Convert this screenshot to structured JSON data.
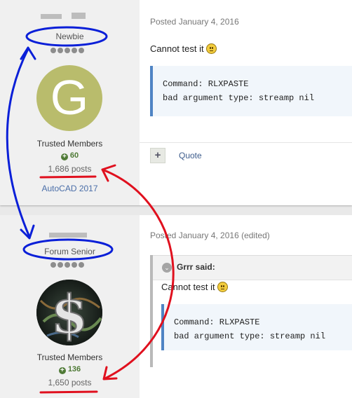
{
  "posts": [
    {
      "author": {
        "rank": "Newbie",
        "group": "Trusted Members",
        "reputation": "60",
        "post_count": "1,686 posts",
        "software": "AutoCAD 2017",
        "avatar_letter": "G",
        "avatar_color": "#b9bc6c"
      },
      "meta": "Posted January 4, 2016",
      "body_text": "Cannot test it",
      "code": "Command: RLXPASTE\nbad argument type: streamp nil",
      "actions": {
        "plus": "+",
        "quote": "Quote"
      }
    },
    {
      "author": {
        "rank": "Forum Senior",
        "group": "Trusted Members",
        "reputation": "136",
        "post_count": "1,650 posts"
      },
      "meta": "Posted January 4, 2016 (edited)",
      "quote": {
        "header": "Grrr said:",
        "text": "Cannot test it",
        "code": "Command: RLXPASTE\nbad argument type: streamp nil"
      }
    }
  ],
  "annotations": {
    "blue": "#0a1fd8",
    "red": "#e0101e"
  }
}
